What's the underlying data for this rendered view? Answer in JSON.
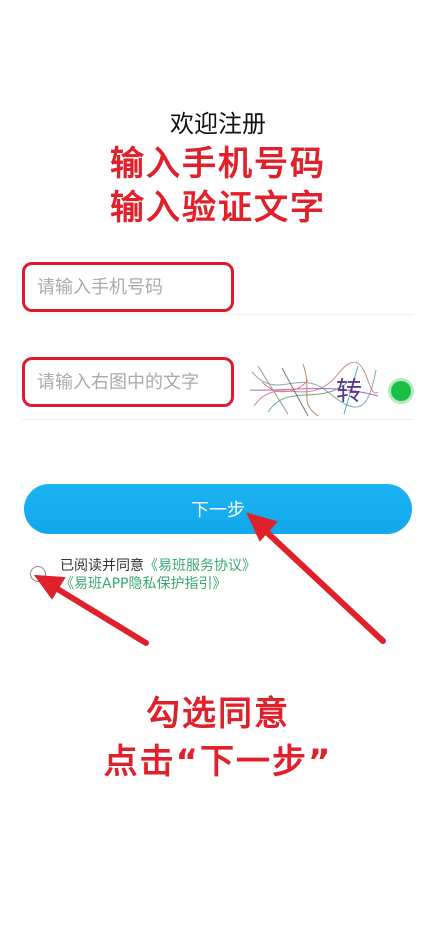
{
  "page": {
    "title": "欢迎注册"
  },
  "annotations": {
    "top_line1": "输入手机号码",
    "top_line2": "输入验证文字",
    "bottom_line1": "勾选同意",
    "bottom_line2": "点击“下一步”",
    "color": "#e0202a"
  },
  "form": {
    "phone_placeholder": "请输入手机号码",
    "captcha_placeholder": "请输入右图中的文字",
    "captcha_text": "转",
    "next_label": "下一步"
  },
  "agreement": {
    "prefix": "已阅读并同意",
    "link1": "《易班服务协议》",
    "link2": "《易班APP隐私保护指引》"
  },
  "colors": {
    "accent": "#13a7ec",
    "highlight": "#e01a2c",
    "link": "#3aa874",
    "refresh": "#1bbf45"
  }
}
